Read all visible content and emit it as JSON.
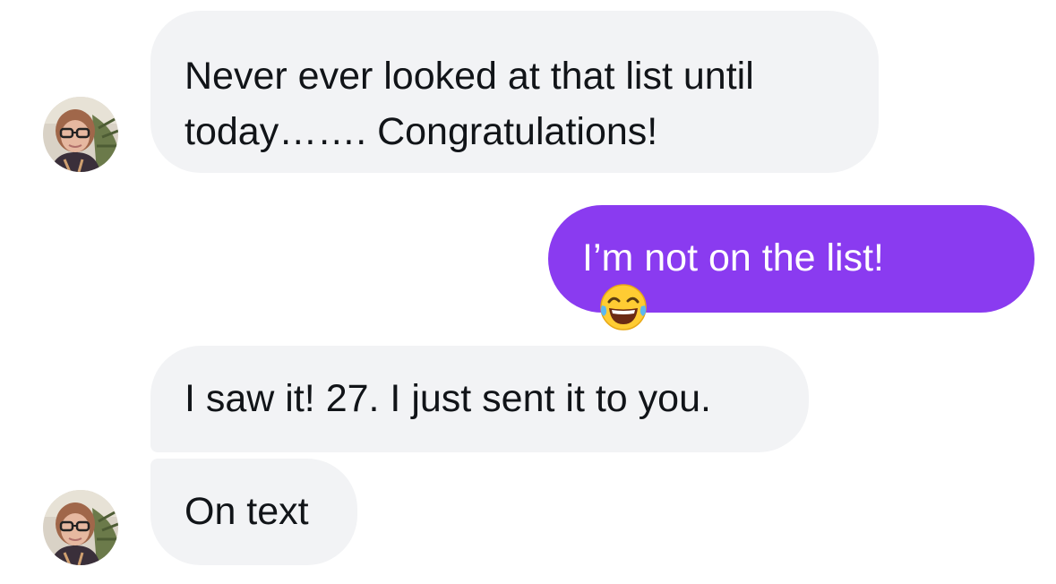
{
  "colors": {
    "incoming_bubble": "#f2f3f5",
    "outgoing_bubble": "#8a3bf0",
    "incoming_text": "#111418",
    "outgoing_text": "#ffffff"
  },
  "messages": [
    {
      "direction": "incoming",
      "lines": [
        "Never ever looked at that list until",
        "today……. Congratulations!"
      ]
    },
    {
      "direction": "outgoing",
      "text": "I’m not on the list!",
      "emoji": "face-with-tears-of-joy-icon"
    },
    {
      "direction": "incoming",
      "text": "I saw it! 27. I just sent it to you."
    },
    {
      "direction": "incoming",
      "text": "On text"
    }
  ],
  "avatars": [
    {
      "icon": "user-avatar-photo"
    },
    {
      "icon": "user-avatar-photo"
    }
  ]
}
